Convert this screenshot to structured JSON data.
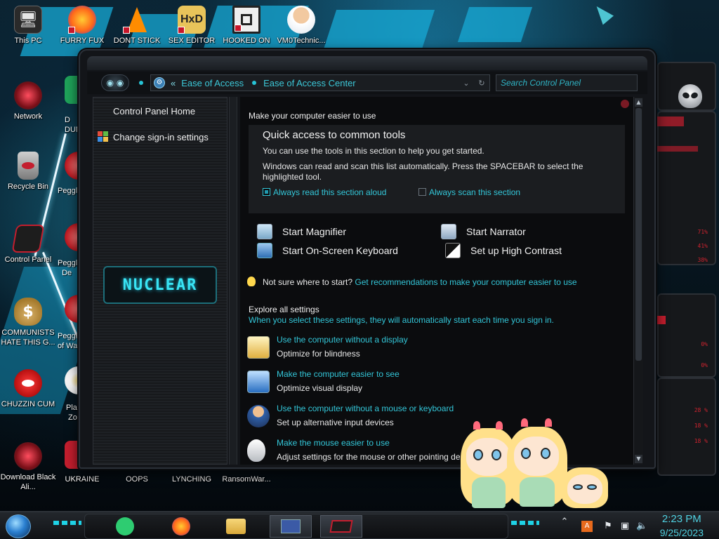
{
  "desktop": {
    "icons": [
      {
        "label": "This PC",
        "icon": "monitor-icon",
        "color": "#2a2a2a"
      },
      {
        "label": "FURRY FUX",
        "icon": "firefox-icon",
        "color": "#ff7a18"
      },
      {
        "label": "DONT STICK",
        "icon": "vlc-cone-icon",
        "color": "#ff8c00"
      },
      {
        "label": "SEX EDITOR",
        "icon": "hxd-editor-icon",
        "color": "#e9c45a"
      },
      {
        "label": "HOOKED ON",
        "icon": "maze-app-icon",
        "color": "#c41e2e"
      },
      {
        "label": "VM0Technic...",
        "icon": "doctor-icon",
        "color": "#f2c9a0"
      },
      {
        "label": "Network",
        "icon": "network-icon",
        "color": "#b01e2a"
      },
      {
        "label": "Recycle Bin",
        "icon": "recycle-bin-icon",
        "color": "#c8c8c8"
      },
      {
        "label": "Control Panel",
        "icon": "control-panel-icon",
        "color": "#c41e2e"
      },
      {
        "label": "COMMUNISTS HATE THIS G...",
        "icon": "money-bag-icon",
        "color": "#c89a3c"
      },
      {
        "label": "CHUZZIN CUM",
        "icon": "chuzzle-icon",
        "color": "#d01818"
      },
      {
        "label": "Download Black Ali...",
        "icon": "alienware-icon",
        "color": "#b01e2a"
      },
      {
        "label": "UKRAINE",
        "icon": "app-icon",
        "color": "#333"
      },
      {
        "label": "OOPS",
        "icon": "app-icon",
        "color": "#333"
      },
      {
        "label": "LYNCHING",
        "icon": "app-icon",
        "color": "#333"
      },
      {
        "label": "RansomWar...",
        "icon": "app-icon",
        "color": "#333"
      }
    ],
    "partial_icons": [
      {
        "label": "D\nDUM",
        "color": "#1fa35a"
      },
      {
        "label": "Peggle",
        "color": "#d01a1a"
      },
      {
        "label": "Peggle\nDe",
        "color": "#d01a1a"
      },
      {
        "label": "Peggle\nof Wa",
        "color": "#d01a1a"
      },
      {
        "label": "Plan\nZo",
        "color": "#e8e8e8"
      }
    ]
  },
  "window": {
    "breadcrumb": [
      "Ease of Access",
      "Ease of Access Center"
    ],
    "breadcrumb_prefix": "«",
    "search_placeholder": "Search Control Panel",
    "sidebar": {
      "home": "Control Panel Home",
      "signin": "Change sign-in settings",
      "logo_text": "NUCLEAR"
    },
    "content": {
      "header": "Make your computer easier to use",
      "quick_title": "Quick access to common tools",
      "quick_desc": "You can use the tools in this section to help you get started.",
      "quick_desc2_line1": "Windows can read and scan this list automatically.  Press the SPACEBAR to select the",
      "quick_desc2_line2": "highlighted tool.",
      "cb_read": "Always read this section aloud",
      "cb_read_checked": true,
      "cb_scan": "Always scan this section",
      "cb_scan_checked": false,
      "tools": [
        {
          "label": "Start Magnifier",
          "icon": "magnifier-icon"
        },
        {
          "label": "Start Narrator",
          "icon": "narrator-icon"
        },
        {
          "label": "Start On-Screen Keyboard",
          "icon": "keyboard-icon"
        },
        {
          "label": "Set up High Contrast",
          "icon": "high-contrast-icon"
        }
      ],
      "not_sure": "Not sure where to start?",
      "recommend_link": "Get recommendations to make your computer easier to use",
      "explore_title": "Explore all settings",
      "explore_desc": "When you select these settings, they will automatically start each time you sign in.",
      "settings": [
        {
          "title": "Use the computer without a display",
          "subtitle": "Optimize for blindness",
          "icon": "no-display-icon"
        },
        {
          "title": "Make the computer easier to see",
          "subtitle": "Optimize visual display",
          "icon": "monitor-see-icon"
        },
        {
          "title": "Use the computer without a mouse or keyboard",
          "subtitle": "Set up alternative input devices",
          "icon": "headset-user-icon"
        },
        {
          "title": "Make the mouse easier to use",
          "subtitle": "Adjust settings for the mouse or other pointing de",
          "icon": "mouse-icon"
        }
      ]
    }
  },
  "hud": {
    "readouts": [
      "71%",
      "41%",
      "38%",
      "0%",
      "0%",
      "28 %",
      "18 %",
      "18 %"
    ],
    "accent": "#d0232f"
  },
  "taskbar": {
    "apps": [
      {
        "name": "notes-app-icon",
        "color": "#2ecc71"
      },
      {
        "name": "firefox-icon",
        "color": "#ff7a18"
      },
      {
        "name": "file-explorer-icon",
        "color": "#f2c14e"
      },
      {
        "name": "control-panel-window-icon",
        "color": "#3b5aa6"
      },
      {
        "name": "alienware-app-icon",
        "color": "#c41e2e"
      }
    ],
    "time": "2:23 PM",
    "date": "9/25/2023"
  },
  "colors": {
    "link": "#33c6d8",
    "accent_cyan": "#1fd2e6",
    "window_bg": "#131519"
  }
}
